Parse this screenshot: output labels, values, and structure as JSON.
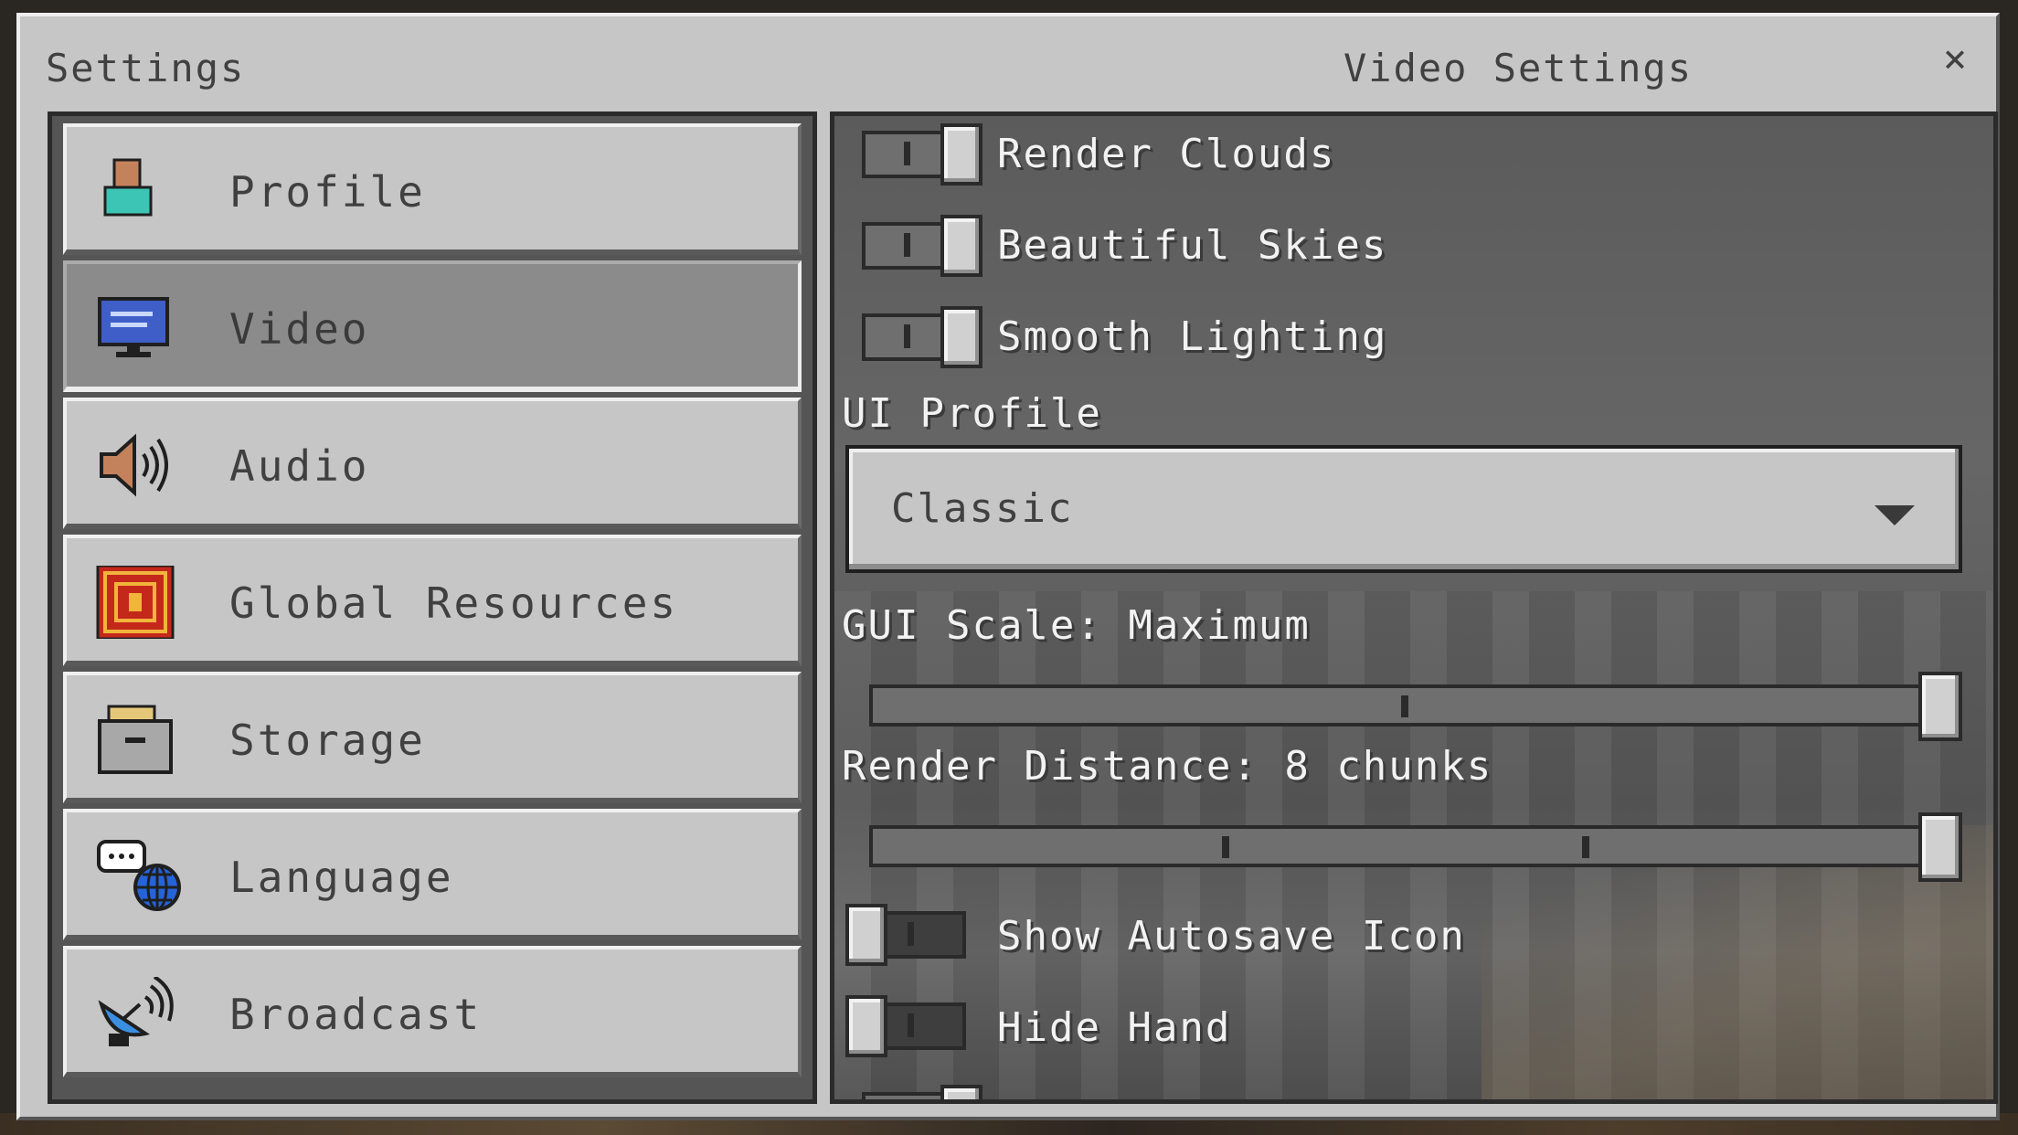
{
  "window": {
    "title": "Settings",
    "panel_title": "Video Settings",
    "close_glyph": "×"
  },
  "sidebar": {
    "items": [
      {
        "label": "Profile",
        "icon": "profile-icon",
        "selected": false
      },
      {
        "label": "Video",
        "icon": "monitor-icon",
        "selected": true
      },
      {
        "label": "Audio",
        "icon": "speaker-icon",
        "selected": false
      },
      {
        "label": "Global Resources",
        "icon": "resource-pack-icon",
        "selected": false
      },
      {
        "label": "Storage",
        "icon": "storage-box-icon",
        "selected": false
      },
      {
        "label": "Language",
        "icon": "language-globe-icon",
        "selected": false
      },
      {
        "label": "Broadcast",
        "icon": "satellite-dish-icon",
        "selected": false
      }
    ]
  },
  "video": {
    "render_clouds": {
      "label": "Render Clouds",
      "on": true
    },
    "beautiful_skies": {
      "label": "Beautiful Skies",
      "on": true
    },
    "smooth_lighting": {
      "label": "Smooth Lighting",
      "on": true
    },
    "ui_profile": {
      "label": "UI Profile",
      "value": "Classic"
    },
    "gui_scale": {
      "label": "GUI Scale: Maximum",
      "level": 1.0
    },
    "render_distance": {
      "label": "Render Distance: 8 chunks",
      "level": 1.0
    },
    "show_autosave_icon": {
      "label": "Show Autosave Icon",
      "on": false
    },
    "hide_hand": {
      "label": "Hide Hand",
      "on": false
    }
  }
}
